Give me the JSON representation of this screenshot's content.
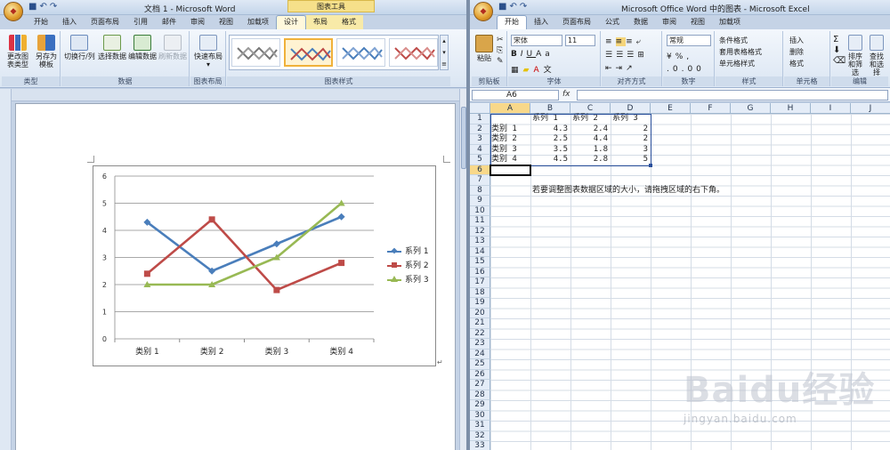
{
  "word": {
    "title": "文档 1 - Microsoft Word",
    "chart_tools_label": "图表工具",
    "tabs": [
      "开始",
      "插入",
      "页面布局",
      "引用",
      "邮件",
      "审阅",
      "视图",
      "加载项",
      "设计",
      "布局",
      "格式"
    ],
    "active_tab": "设计",
    "ribbon": {
      "groups": [
        "类型",
        "数据",
        "图表布局",
        "图表样式"
      ],
      "buttons": {
        "change_type": "更改图表类型",
        "save_template": "另存为模板",
        "switch_row_col": "切换行/列",
        "select_data": "选择数据",
        "edit_data": "编辑数据",
        "refresh_data": "刷新数据",
        "quick_layout": "快速布局"
      }
    },
    "chart_data": {
      "type": "line",
      "categories": [
        "类别 1",
        "类别 2",
        "类别 3",
        "类别 4"
      ],
      "series": [
        {
          "name": "系列 1",
          "values": [
            4.3,
            2.5,
            3.5,
            4.5
          ],
          "color": "#4a7ebb"
        },
        {
          "name": "系列 2",
          "values": [
            2.4,
            4.4,
            1.8,
            2.8
          ],
          "color": "#be4b48"
        },
        {
          "name": "系列 3",
          "values": [
            2,
            2,
            3,
            5
          ],
          "color": "#98b954"
        }
      ],
      "ylim": [
        0,
        6
      ],
      "yticks": [
        "0",
        "1",
        "2",
        "3",
        "4",
        "5",
        "6"
      ],
      "grid": true,
      "legend": "right"
    }
  },
  "excel": {
    "title": "Microsoft Office Word 中的图表 - Microsoft Excel",
    "tabs": [
      "开始",
      "插入",
      "页面布局",
      "公式",
      "数据",
      "审阅",
      "视图",
      "加载项"
    ],
    "active_tab": "开始",
    "ribbon": {
      "groups": [
        "剪贴板",
        "字体",
        "对齐方式",
        "数字",
        "样式",
        "单元格",
        "编辑"
      ],
      "paste": "粘贴",
      "font_name": "宋体",
      "font_size": "11",
      "number_format": "常规",
      "styles": [
        "条件格式",
        "套用表格格式",
        "单元格样式"
      ],
      "cells": [
        "插入",
        "删除",
        "格式"
      ],
      "editing": [
        "排序和筛选",
        "查找和选择"
      ]
    },
    "name_box": "A6",
    "fx": "fx",
    "columns": [
      "A",
      "B",
      "C",
      "D",
      "E",
      "F",
      "G",
      "H",
      "I",
      "J"
    ],
    "rows": [
      "1",
      "2",
      "3",
      "4",
      "5",
      "6",
      "7",
      "8",
      "9",
      "10",
      "11",
      "12",
      "13",
      "14",
      "15",
      "16",
      "17",
      "18",
      "19",
      "20",
      "21",
      "22",
      "23",
      "24",
      "25",
      "26",
      "27",
      "28",
      "29",
      "30",
      "31",
      "32",
      "33"
    ],
    "table": {
      "headers": [
        "系列 1",
        "系列 2",
        "系列 3"
      ],
      "rows": [
        {
          "label": "类别 1",
          "values": [
            "4.3",
            "2.4",
            "2"
          ]
        },
        {
          "label": "类别 2",
          "values": [
            "2.5",
            "4.4",
            "2"
          ]
        },
        {
          "label": "类别 3",
          "values": [
            "3.5",
            "1.8",
            "3"
          ]
        },
        {
          "label": "类别 4",
          "values": [
            "4.5",
            "2.8",
            "5"
          ]
        }
      ]
    },
    "note": "若要调整图表数据区域的大小，请拖拽区域的右下角。"
  },
  "watermark": {
    "brand": "Baidu经验",
    "url": "jingyan.baidu.com"
  }
}
